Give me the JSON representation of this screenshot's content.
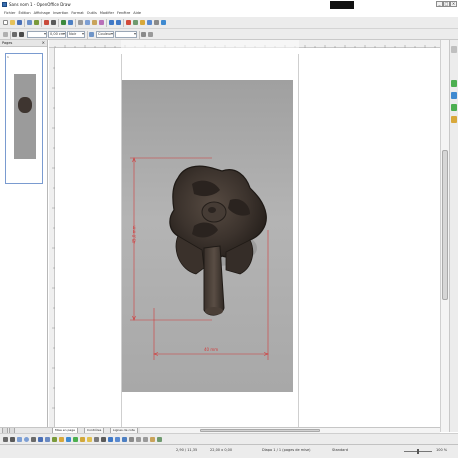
{
  "window": {
    "title": "Sans nom 1 - OpenOffice Draw",
    "controls": {
      "minimize": "_",
      "maximize": "□",
      "close": "×"
    }
  },
  "menubar": {
    "items": [
      "Fichier",
      "Édition",
      "Affichage",
      "Insertion",
      "Format",
      "Outils",
      "Modifier",
      "Fenêtre",
      "Aide"
    ]
  },
  "formatting_toolbar": {
    "line_width": "0,00 cm",
    "line_color": "Noir",
    "area_style": "Couleur"
  },
  "pages_panel": {
    "title": "Pages",
    "close_icon": "×",
    "page_number": "1"
  },
  "document": {
    "measure_vertical": "45,0 mm",
    "measure_horizontal": "40 mm"
  },
  "tabs": [
    {
      "label": "Mise en page"
    },
    {
      "label": "Contrôles"
    },
    {
      "label": "Lignes de cote"
    }
  ],
  "statusbar": {
    "position": "2,90 / 11,35",
    "size": "22,00 x 0,00",
    "slide": "Diapo 1 / 1 (pages de mise)",
    "layout": "Standard",
    "zoom": "100 %"
  },
  "colors": {
    "toolbar_bg": "#ececec",
    "measure_red": "#d23b3b",
    "object_dark": "#3c332d",
    "photo_bg": "#a8a8a8"
  }
}
